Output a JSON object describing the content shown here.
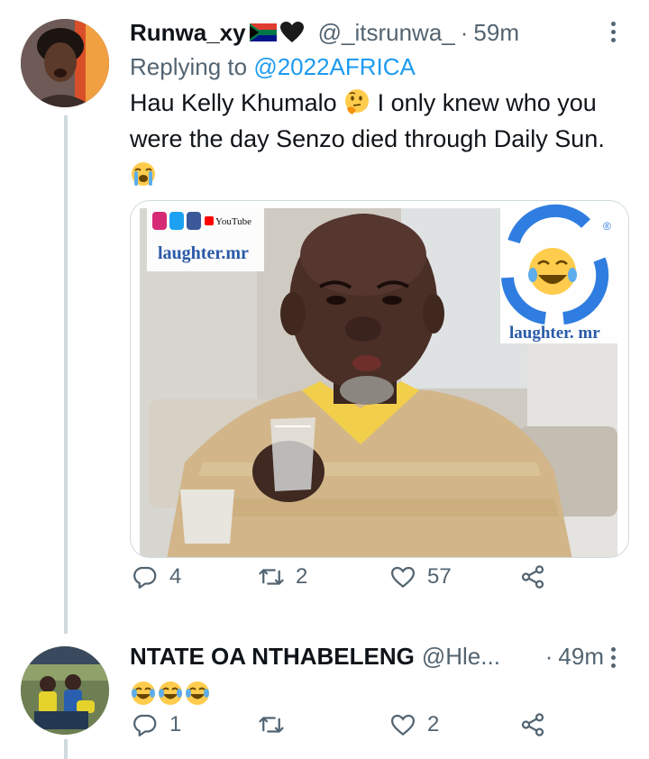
{
  "tweets": [
    {
      "name": "Runwa_xy",
      "handle": "@_itsrunwa_",
      "dot": "·",
      "time": "59m",
      "reply_prefix": "Replying to ",
      "reply_to": "@2022AFRICA",
      "text": "Hau Kelly Khumalo",
      "text_cont": " I only knew who you were the day Senzo died through Daily Sun.",
      "media": {
        "watermark_left": "laughter.mr",
        "watermark_right": "laughter. mr",
        "registered": "®",
        "social_youtube": "YouTube"
      },
      "actions": {
        "replies": "4",
        "retweets": "2",
        "likes": "57"
      }
    },
    {
      "name": "NTATE OA NTHABELENG",
      "handle": "@Hle...",
      "dot": "·",
      "time": "49m",
      "actions": {
        "replies": "1",
        "retweets": "",
        "likes": "2"
      }
    }
  ],
  "colors": {
    "text": "#0f1419",
    "secondary": "#536471",
    "link": "#1d9bf0",
    "thread_line": "#cfd9de"
  },
  "icons": [
    "reply-icon",
    "retweet-icon",
    "like-icon",
    "share-icon",
    "more-icon",
    "thinking-face-emoji",
    "crying-laughing-emoji",
    "loudly-crying-emoji",
    "south-africa-flag",
    "black-heart-emoji"
  ]
}
